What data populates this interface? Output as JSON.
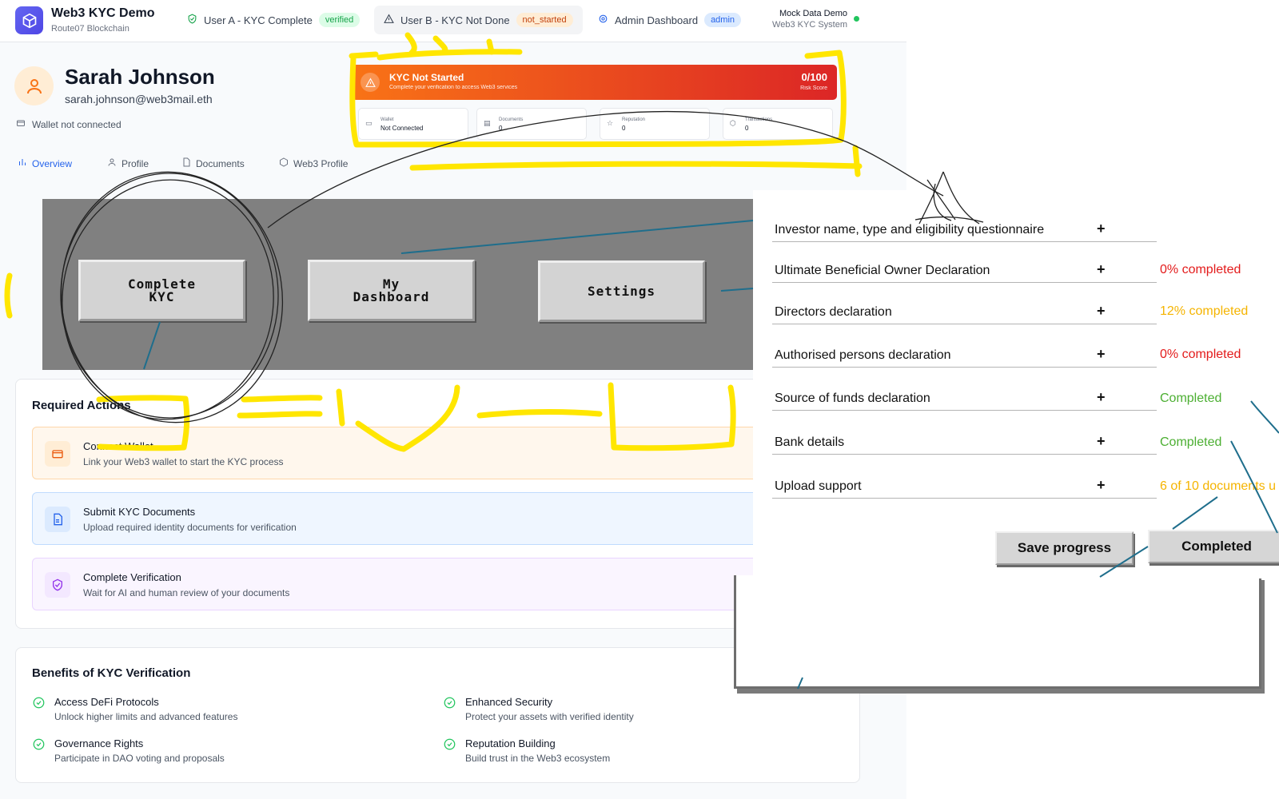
{
  "header": {
    "brand_title": "Web3 KYC Demo",
    "brand_subtitle": "Route07 Blockchain",
    "tabs": [
      {
        "label": "User A - KYC Complete",
        "badge": "verified"
      },
      {
        "label": "User B - KYC Not Done",
        "badge": "not_started"
      },
      {
        "label": "Admin Dashboard",
        "badge": "admin"
      }
    ],
    "mock_title": "Mock Data Demo",
    "mock_subtitle": "Web3 KYC System"
  },
  "profile": {
    "name": "Sarah Johnson",
    "email": "sarah.johnson@web3mail.eth",
    "wallet_status": "Wallet not connected"
  },
  "kyc_banner": {
    "title": "KYC Not Started",
    "subtitle": "Complete your verification to access Web3 services",
    "score": "0/100",
    "score_label": "Risk Score"
  },
  "stats": [
    {
      "label": "Wallet",
      "value": "Not Connected"
    },
    {
      "label": "Documents",
      "value": "0"
    },
    {
      "label": "Reputation",
      "value": "0"
    },
    {
      "label": "Transactions",
      "value": "0"
    }
  ],
  "nav_tabs": [
    "Overview",
    "Profile",
    "Documents",
    "Web3 Profile"
  ],
  "required_actions": {
    "title": "Required Actions",
    "items": [
      {
        "title": "Connect Wallet",
        "desc": "Link your Web3 wallet to start the KYC process"
      },
      {
        "title": "Submit KYC Documents",
        "desc": "Upload required identity documents for verification"
      },
      {
        "title": "Complete Verification",
        "desc": "Wait for AI and human review of your documents"
      }
    ]
  },
  "benefits": {
    "title": "Benefits of KYC Verification",
    "items": [
      {
        "title": "Access DeFi Protocols",
        "desc": "Unlock higher limits and advanced features"
      },
      {
        "title": "Enhanced Security",
        "desc": "Protect your assets with verified identity"
      },
      {
        "title": "Governance Rights",
        "desc": "Participate in DAO voting and proposals"
      },
      {
        "title": "Reputation Building",
        "desc": "Build trust in the Web3 ecosystem"
      }
    ]
  },
  "menu_buttons": [
    "Complete\nKYC",
    "My\nDashboard",
    "Settings"
  ],
  "questionnaire": {
    "rows": [
      {
        "label": "Investor name, type and eligibility questionnaire",
        "plus": "+",
        "status": ""
      },
      {
        "label": "Ultimate Beneficial Owner Declaration",
        "plus": "+",
        "status": "0% completed"
      },
      {
        "label": "Directors declaration",
        "plus": "+",
        "status": "12% completed"
      },
      {
        "label": "Authorised persons declaration",
        "plus": "+",
        "status": "0% completed"
      },
      {
        "label": "Source of funds declaration",
        "plus": "+",
        "status": "Completed"
      },
      {
        "label": "Bank details",
        "plus": "+",
        "status": "Completed"
      },
      {
        "label": "Upload support",
        "plus": "+",
        "status": "6 of 10 documents u"
      }
    ],
    "status_colors": [
      "#111111",
      "#e31b1b",
      "#f5b400",
      "#e31b1b",
      "#4caf32",
      "#4caf32",
      "#f5b400"
    ],
    "save_button": "Save progress",
    "completed_button": "Completed"
  },
  "colors": {
    "accent": "#2563eb",
    "banner_from": "#f97316",
    "banner_to": "#dc2626",
    "highlighter": "#ffe600"
  }
}
